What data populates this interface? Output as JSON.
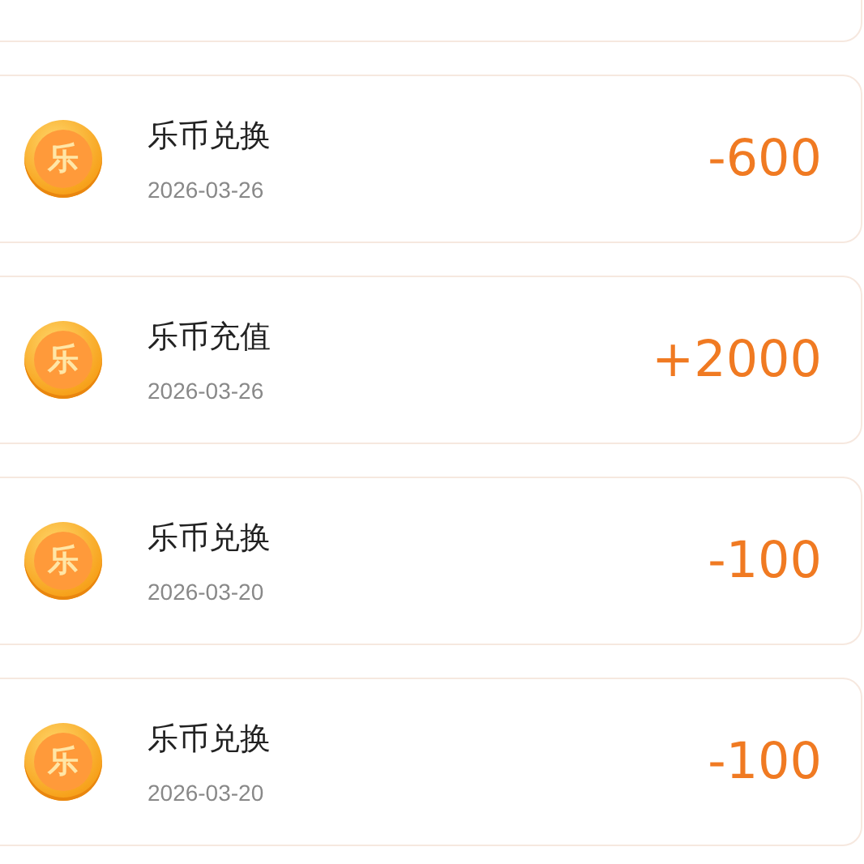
{
  "records": [
    {
      "title": "乐币兑换",
      "date": "2026-03-26",
      "amount": "-600",
      "coin_label": "乐"
    },
    {
      "title": "乐币充值",
      "date": "2026-03-26",
      "amount": "+2000",
      "coin_label": "乐"
    },
    {
      "title": "乐币兑换",
      "date": "2026-03-20",
      "amount": "-100",
      "coin_label": "乐"
    },
    {
      "title": "乐币兑换",
      "date": "2026-03-20",
      "amount": "-100",
      "coin_label": "乐"
    }
  ]
}
